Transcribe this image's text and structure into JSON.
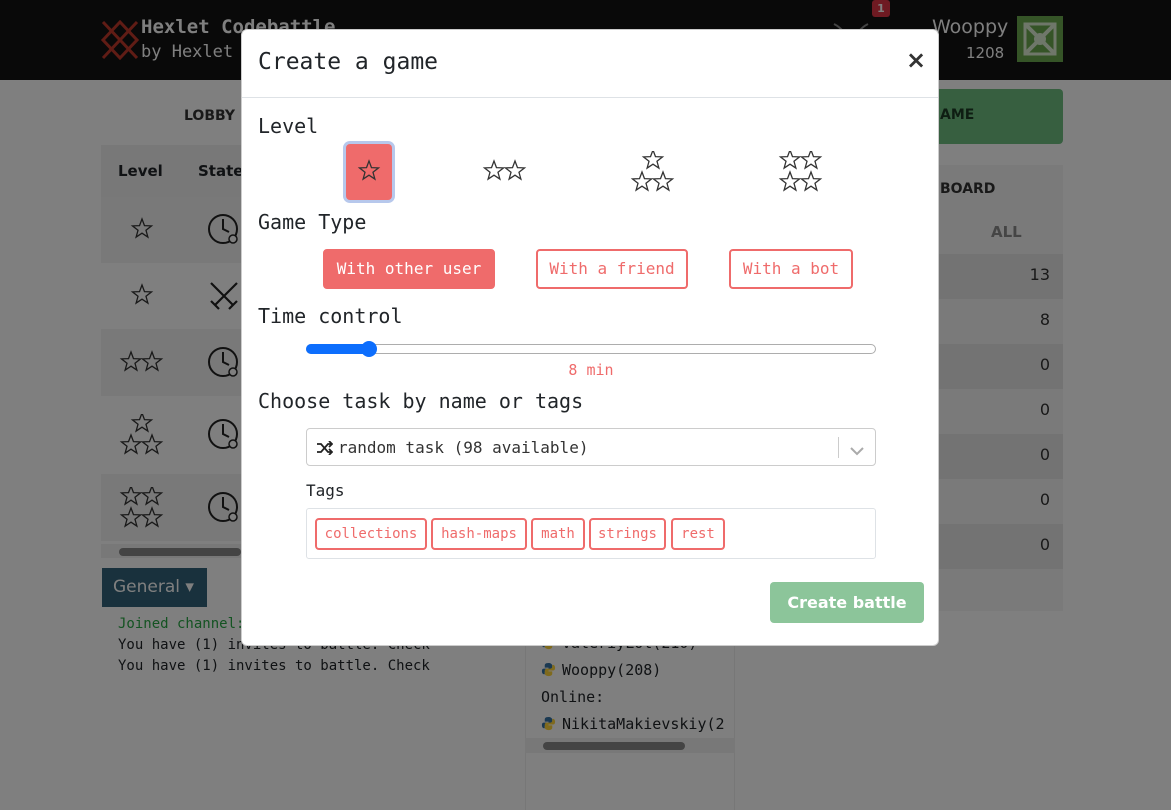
{
  "header": {
    "brand_title": "Hexlet Codebattle",
    "brand_sub": "by Hexlet",
    "notification_count": "1",
    "user_name": "Wooppy",
    "user_rating": "1208"
  },
  "lobby": {
    "tab_label": "LOBBY",
    "columns": {
      "level": "Level",
      "state": "State"
    },
    "rows": [
      {
        "level": 1,
        "state": "waiting-icon"
      },
      {
        "level": 1,
        "state": "battle-icon"
      },
      {
        "level": 2,
        "state": "waiting-icon"
      },
      {
        "level": 3,
        "state": "waiting-icon"
      },
      {
        "level": 4,
        "state": "waiting-icon"
      }
    ]
  },
  "chat": {
    "channel_button": "General",
    "lines": [
      {
        "text": "Joined channel:",
        "kind": "system"
      },
      {
        "text": "You have (1) invites to battle. Check",
        "kind": "normal"
      },
      {
        "text": "You have (1) invites to battle. Check",
        "kind": "normal"
      }
    ]
  },
  "online_users": {
    "lines": [
      "ValeriyLol(210)",
      "Wooppy(208)"
    ],
    "online_label": "Online:",
    "online": [
      "NikitaMakievskiy(2"
    ]
  },
  "create_game_button_tail": "AME",
  "leaderboard": {
    "title_tail": "BOARD",
    "filter_all": "ALL",
    "values": [
      "13",
      "8",
      "0",
      "0",
      "0",
      "0",
      "0"
    ]
  },
  "modal": {
    "title": "Create a game",
    "close_label": "×",
    "level_label": "Level",
    "levels": [
      {
        "name": "elementary",
        "stars": 1,
        "active": true
      },
      {
        "name": "easy",
        "stars": 2,
        "active": false
      },
      {
        "name": "medium",
        "stars": 3,
        "active": false
      },
      {
        "name": "hard",
        "stars": 4,
        "active": false
      }
    ],
    "game_type_label": "Game Type",
    "game_types": [
      {
        "label": "With other user",
        "active": true
      },
      {
        "label": "With a friend",
        "active": false
      },
      {
        "label": "With a bot",
        "active": false
      }
    ],
    "time_control_label": "Time control",
    "time_control": {
      "value_label": "8 min",
      "value_fraction": 0.1
    },
    "task_label": "Choose task by name or tags",
    "task_select_value": "random task (98 available)",
    "tags_label": "Tags",
    "tags": [
      "collections",
      "hash-maps",
      "math",
      "strings",
      "rest"
    ],
    "submit_label": "Create battle"
  },
  "colors": {
    "accent": "#ef6b6b",
    "primary": "#0d6efd",
    "submit": "#8cc59a",
    "topbar": "#121212"
  }
}
